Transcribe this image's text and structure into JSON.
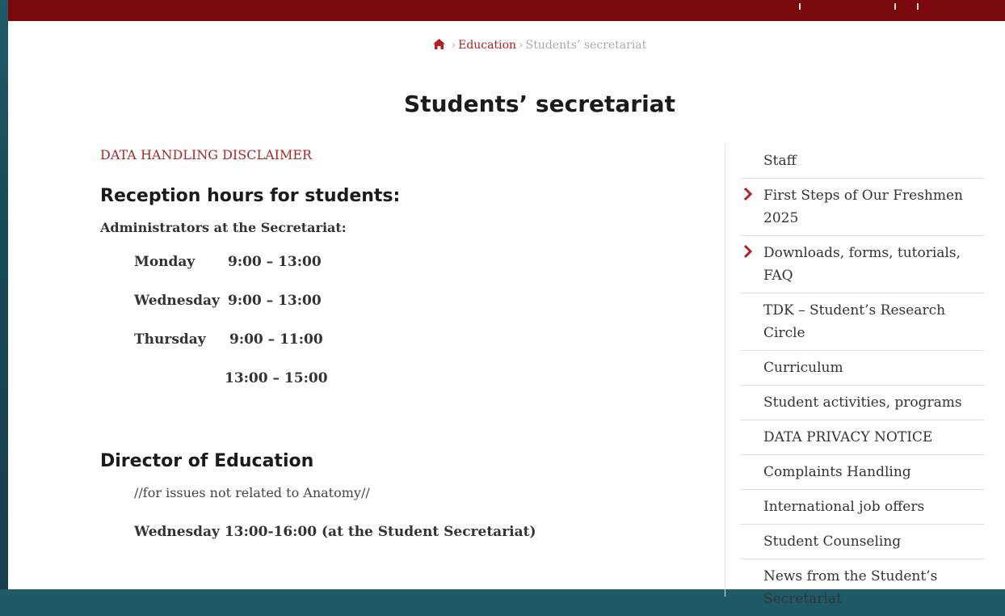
{
  "breadcrumb": {
    "home_icon": "home-icon",
    "items": [
      "Education",
      "Students’ secretariat"
    ],
    "separator": ">"
  },
  "page_title": "Students’ secretariat",
  "main": {
    "disclaimer_link": "DATA HANDLING DISCLAIMER",
    "reception_heading": "Reception hours for students:",
    "admin_label": "Administrators at the Secretariat:",
    "hours": [
      {
        "day": "Monday",
        "time": "9:00 – 13:00"
      },
      {
        "day": "Wednesday",
        "time": "9:00 – 13:00"
      },
      {
        "day": "Thursday",
        "time": "9:00 – 11:00"
      },
      {
        "day": "",
        "time": "13:00 – 15:00"
      }
    ],
    "director_heading": "Director of Education",
    "director_note": "//for issues not related to Anatomy//",
    "director_hours": "Wednesday 13:00-16:00 (at the Student Secretariat)"
  },
  "sidebar": {
    "items": [
      {
        "label": "Staff",
        "has_submenu": false
      },
      {
        "label": "First Steps of Our Freshmen 2025",
        "has_submenu": true
      },
      {
        "label": "Downloads, forms, tutorials, FAQ",
        "has_submenu": true
      },
      {
        "label": "TDK – Student’s Research Circle",
        "has_submenu": false
      },
      {
        "label": "Curriculum",
        "has_submenu": false
      },
      {
        "label": "Student activities, programs",
        "has_submenu": false
      },
      {
        "label": "DATA PRIVACY NOTICE",
        "has_submenu": false
      },
      {
        "label": "Complaints Handling",
        "has_submenu": false
      },
      {
        "label": "International job offers",
        "has_submenu": false
      },
      {
        "label": "Student Counseling",
        "has_submenu": false
      },
      {
        "label": "News from the Student’s Secretariat",
        "has_submenu": false
      }
    ]
  },
  "colors": {
    "brand_red": "#7a0a0e",
    "link_red": "#b21f24",
    "background_teal": "#1f5a68"
  }
}
